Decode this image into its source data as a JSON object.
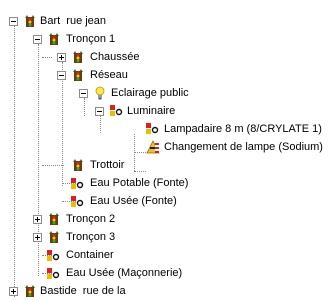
{
  "tree": {
    "nodes": [
      {
        "label": "Bart  rue jean",
        "icon": "traffic-light-icon",
        "state": "expanded"
      },
      {
        "label": "Tronçon 1",
        "icon": "traffic-light-icon",
        "state": "expanded"
      },
      {
        "label": "Chaussée",
        "icon": "traffic-light-icon",
        "state": "collapsed"
      },
      {
        "label": "Réseau",
        "icon": "traffic-light-icon",
        "state": "expanded"
      },
      {
        "label": "Eclairage public",
        "icon": "light-bulb-icon",
        "state": "expanded"
      },
      {
        "label": "Luminaire",
        "icon": "lamp-node-icon",
        "state": "expanded"
      },
      {
        "label": "Lampadaire 8 m (8/CRYLATE 1)",
        "icon": "lamp-node-icon",
        "state": "leaf"
      },
      {
        "label": "Changement de lampe (Sodium)",
        "icon": "road-works-icon",
        "state": "leaf"
      },
      {
        "label": "Trottoir",
        "icon": "traffic-light-icon",
        "state": "leaf"
      },
      {
        "label": "Eau Potable (Fonte)",
        "icon": "lamp-node-icon",
        "state": "leaf"
      },
      {
        "label": "Eau Usée (Fonte)",
        "icon": "lamp-node-icon",
        "state": "leaf"
      },
      {
        "label": "Tronçon 2",
        "icon": "traffic-light-icon",
        "state": "collapsed"
      },
      {
        "label": "Tronçon 3",
        "icon": "traffic-light-icon",
        "state": "collapsed"
      },
      {
        "label": "Container",
        "icon": "lamp-node-icon",
        "state": "leaf"
      },
      {
        "label": "Eau Usée (Maçonnerie)",
        "icon": "lamp-node-icon",
        "state": "leaf"
      },
      {
        "label": "Bastide  rue de la",
        "icon": "traffic-light-icon",
        "state": "collapsed"
      }
    ]
  }
}
